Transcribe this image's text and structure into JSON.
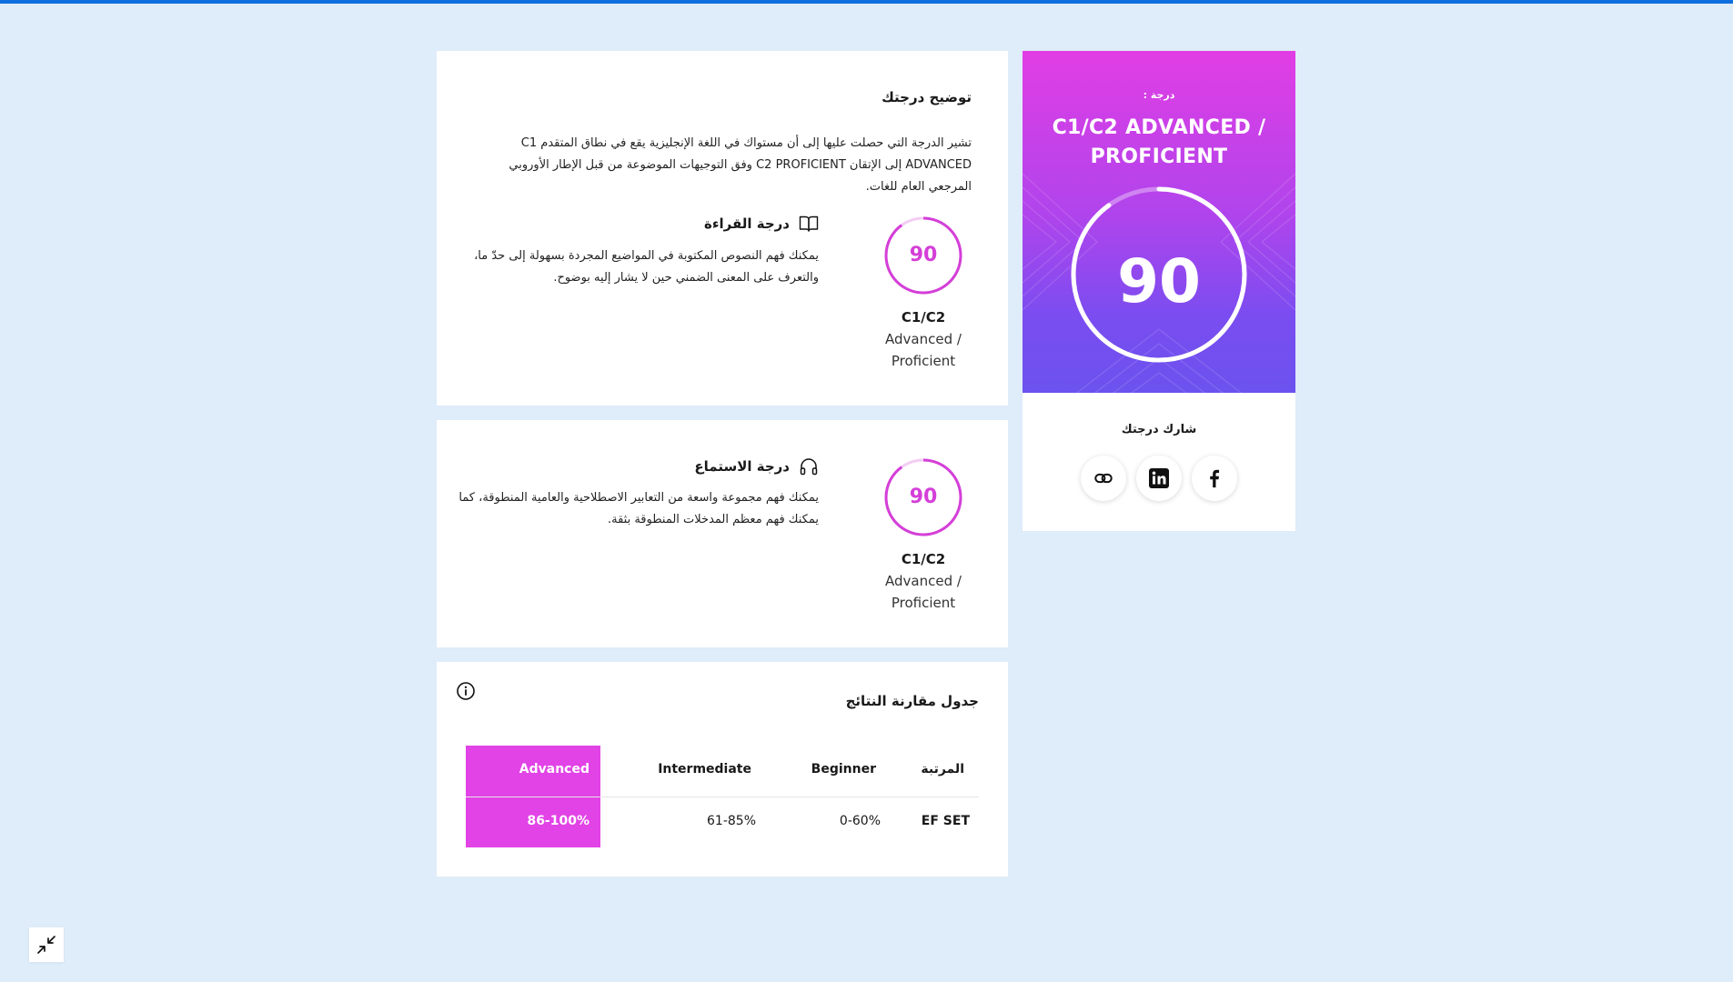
{
  "colors": {
    "page_background": "#dfecf9",
    "top_bar": "#0f6fde",
    "accent_magenta": "#e143e6",
    "gradient_top": "#e13ee4",
    "gradient_bottom": "#6b52ee"
  },
  "score_card": {
    "eyebrow": "درجة :",
    "level": "C1/C2 ADVANCED / PROFICIENT",
    "score": "90",
    "share_title": "شارك درجتك",
    "share_buttons": [
      {
        "icon": "link-icon"
      },
      {
        "icon": "linkedin-icon"
      },
      {
        "icon": "facebook-icon"
      }
    ]
  },
  "explanation": {
    "title": "توضيح درجتك",
    "text": "تشير الدرجة التي حصلت عليها إلى أن مستواك في اللغة الإنجليزية يقع في نطاق المتقدم C1 ADVANCED إلى الإتقان C2 PROFICIENT وفق التوجيهات الموضوعة من قبل الإطار الأوروبي المرجعي العام للغات.",
    "reading": {
      "icon": "book-icon",
      "title": "درجة القراءة",
      "score": "90",
      "level": "C1/C2",
      "level_desc": "Advanced / Proficient",
      "description": "يمكنك فهم النصوص المكتوبة في المواضيع المجردة بسهولة إلى حدّ ما، والتعرف على المعنى الضمني حين لا يشار إليه بوضوح."
    }
  },
  "listening": {
    "icon": "headphones-icon",
    "title": "درجة الاستماع",
    "score": "90",
    "level": "C1/C2",
    "level_desc": "Advanced / Proficient",
    "description": "يمكنك فهم مجموعة واسعة من التعابير الاصطلاحية والعامية المنطوقة، كما يمكنك فهم معظم المدخلات المنطوقة بثقة."
  },
  "comparison": {
    "title": "جدول مقارنة النتائج",
    "info_icon": "info-icon",
    "headers": [
      "المرتبة",
      "Beginner",
      "Intermediate",
      "Advanced"
    ],
    "rows": [
      {
        "label": "EF SET",
        "values": [
          "0-60%",
          "61-85%",
          "86-100%"
        ]
      }
    ]
  },
  "collapse_icon": "collapse-icon"
}
